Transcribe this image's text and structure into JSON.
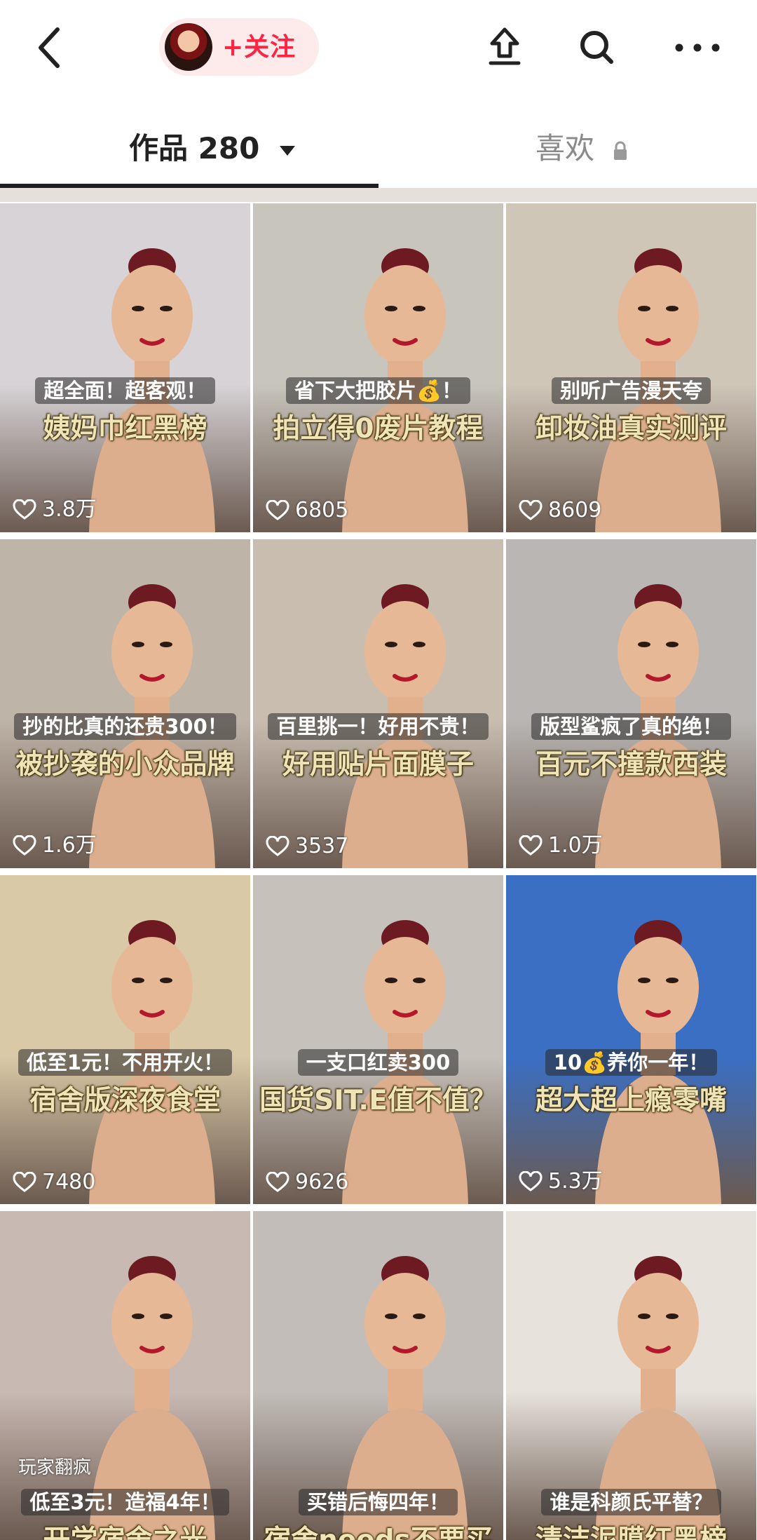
{
  "header": {
    "follow_label": "+关注",
    "icons": [
      "back-arrow-icon",
      "share-icon",
      "search-icon",
      "more-icon"
    ]
  },
  "tabs": {
    "works_label": "作品 280",
    "likes_label": "喜欢"
  },
  "posts": [
    {
      "tag": "超全面！超客观！",
      "title": "姨妈巾红黑榜",
      "likes": "3.8万",
      "bg": "#d7d3d6"
    },
    {
      "tag": "省下大把胶片💰！",
      "title": "拍立得0废片教程",
      "likes": "6805",
      "bg": "#c8c5bd"
    },
    {
      "tag": "别听广告漫天夸",
      "title": "卸妆油真实测评",
      "likes": "8609",
      "bg": "#cfc6b8"
    },
    {
      "tag": "抄的比真的还贵300！",
      "title": "被抄袭的小众品牌",
      "likes": "1.6万",
      "bg": "#bfb4a8"
    },
    {
      "tag": "百里挑一！好用不贵！",
      "title": "好用贴片面膜子",
      "likes": "3537",
      "bg": "#c9bdb0"
    },
    {
      "tag": "版型鲨疯了真的绝！",
      "title": "百元不撞款西装",
      "likes": "1.0万",
      "bg": "#b9b6b3"
    },
    {
      "tag": "低至1元！不用开火！",
      "title": "宿舍版深夜食堂",
      "likes": "7480",
      "bg": "#d9c9a6"
    },
    {
      "tag": "一支口红卖300",
      "title": "国货SIT.E值不值？",
      "likes": "9626",
      "bg": "#c6c2bb"
    },
    {
      "tag": "10💰养你一年！",
      "title": "超大超上瘾零嘴",
      "likes": "5.3万",
      "bg": "#3a6fc4"
    },
    {
      "tag": "低至3元！造福4年！",
      "title": "开学宿舍之光",
      "likes": "",
      "bg": "#c9b9b3"
    },
    {
      "tag": "买错后悔四年！",
      "title": "宿舍needs不要买",
      "likes": "",
      "bg": "#c2bdb9"
    },
    {
      "tag": "谁是科颜氏平替？",
      "title": "清洁泥膜红黑榜",
      "likes": "",
      "bg": "#e7e2dc"
    }
  ],
  "watermark": "玩家翻疯",
  "colors": {
    "accent": "#ff2442",
    "caption_yellow": "#efe3b8"
  }
}
